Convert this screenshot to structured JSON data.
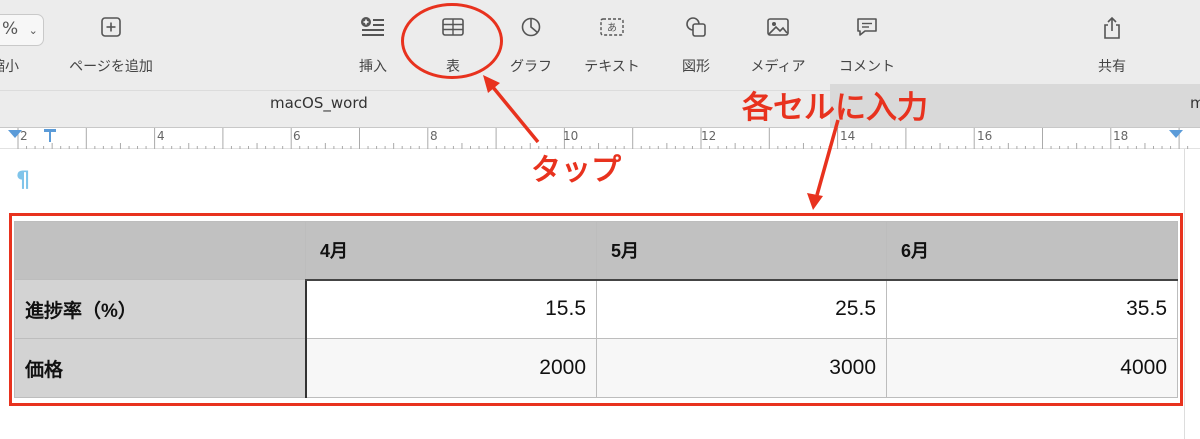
{
  "toolbar": {
    "zoom_value": "%",
    "shrink_label": "縮小",
    "add_page_label": "ページを追加",
    "insert_label": "挿入",
    "table_label": "表",
    "chart_label": "グラフ",
    "text_label": "テキスト",
    "shape_label": "図形",
    "media_label": "メディア",
    "comment_label": "コメント",
    "share_label": "共有",
    "icons": [
      "chevron-down-icon",
      "plus-square-icon",
      "insert-icon",
      "table-icon",
      "pie-chart-icon",
      "text-box-icon",
      "shape-icon",
      "media-icon",
      "comment-icon",
      "share-icon"
    ]
  },
  "tabs": {
    "active_title": "macOS_word",
    "other_title_fragment": "m"
  },
  "ruler": {
    "numbers": [
      "2",
      "4",
      "6",
      "8",
      "10",
      "12",
      "14",
      "16",
      "18"
    ]
  },
  "document": {
    "pilcrow": "¶"
  },
  "table": {
    "headers": [
      "",
      "4月",
      "5月",
      "6月"
    ],
    "rows": [
      {
        "label": "進捗率（%）",
        "values": [
          "15.5",
          "25.5",
          "35.5"
        ]
      },
      {
        "label": "価格",
        "values": [
          "2000",
          "3000",
          "4000"
        ]
      }
    ]
  },
  "annotations": {
    "tap": "タップ",
    "enter_each_cell": "各セルに入力",
    "color": "#e8321e"
  }
}
